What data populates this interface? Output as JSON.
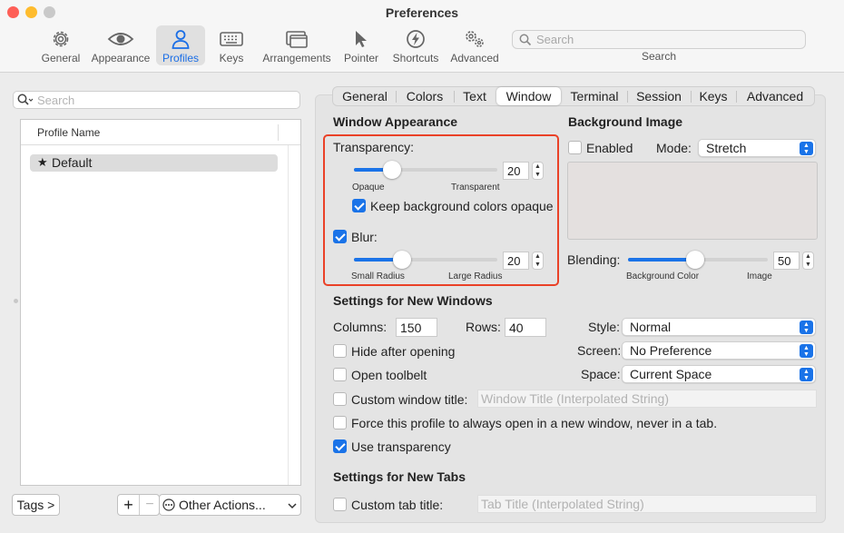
{
  "window": {
    "title": "Preferences"
  },
  "toolbar": {
    "items": [
      {
        "label": "General",
        "icon": "gear-icon"
      },
      {
        "label": "Appearance",
        "icon": "eye-icon"
      },
      {
        "label": "Profiles",
        "icon": "person-icon",
        "active": true
      },
      {
        "label": "Keys",
        "icon": "keyboard-icon"
      },
      {
        "label": "Arrangements",
        "icon": "windows-icon"
      },
      {
        "label": "Pointer",
        "icon": "cursor-icon"
      },
      {
        "label": "Shortcuts",
        "icon": "lightning-icon"
      },
      {
        "label": "Advanced",
        "icon": "gears-icon"
      }
    ],
    "search_placeholder": "Search",
    "search_caption": "Search"
  },
  "profiles": {
    "search_placeholder": "Search",
    "column_header": "Profile Name",
    "items": [
      {
        "name": "Default",
        "default_marker": "★"
      }
    ],
    "tags_button": "Tags >",
    "add_button": "+",
    "remove_button": "−",
    "other_actions": "Other Actions..."
  },
  "tabs": [
    "General",
    "Colors",
    "Text",
    "Window",
    "Terminal",
    "Session",
    "Keys",
    "Advanced"
  ],
  "selected_tab": "Window",
  "window_appearance": {
    "heading": "Window Appearance",
    "transparency_label": "Transparency:",
    "transparency_value": "20",
    "transparency_min_label": "Opaque",
    "transparency_max_label": "Transparent",
    "keep_bg_opaque_label": "Keep background colors opaque",
    "keep_bg_opaque": true,
    "blur_label": "Blur:",
    "blur_enabled": true,
    "blur_value": "20",
    "blur_min_label": "Small Radius",
    "blur_max_label": "Large Radius"
  },
  "background_image": {
    "heading": "Background Image",
    "enabled_label": "Enabled",
    "enabled": false,
    "mode_label": "Mode:",
    "mode_value": "Stretch",
    "blending_label": "Blending:",
    "blending_value": "50",
    "blending_min_label": "Background Color",
    "blending_max_label": "Image"
  },
  "new_windows": {
    "heading": "Settings for New Windows",
    "columns_label": "Columns:",
    "columns_value": "150",
    "rows_label": "Rows:",
    "rows_value": "40",
    "style_label": "Style:",
    "style_value": "Normal",
    "screen_label": "Screen:",
    "screen_value": "No Preference",
    "space_label": "Space:",
    "space_value": "Current Space",
    "hide_after_opening_label": "Hide after opening",
    "open_toolbelt_label": "Open toolbelt",
    "custom_title_label": "Custom window title:",
    "custom_title_placeholder": "Window Title (Interpolated String)",
    "force_new_window_label": "Force this profile to always open in a new window, never in a tab.",
    "use_transparency_label": "Use transparency",
    "use_transparency": true
  },
  "new_tabs": {
    "heading": "Settings for New Tabs",
    "custom_tab_title_label": "Custom tab title:",
    "custom_tab_title_placeholder": "Tab Title (Interpolated String)"
  },
  "colors": {
    "accent": "#1a73e8",
    "highlight": "#ea4127",
    "active_toolbar": "#1a6ee6"
  }
}
